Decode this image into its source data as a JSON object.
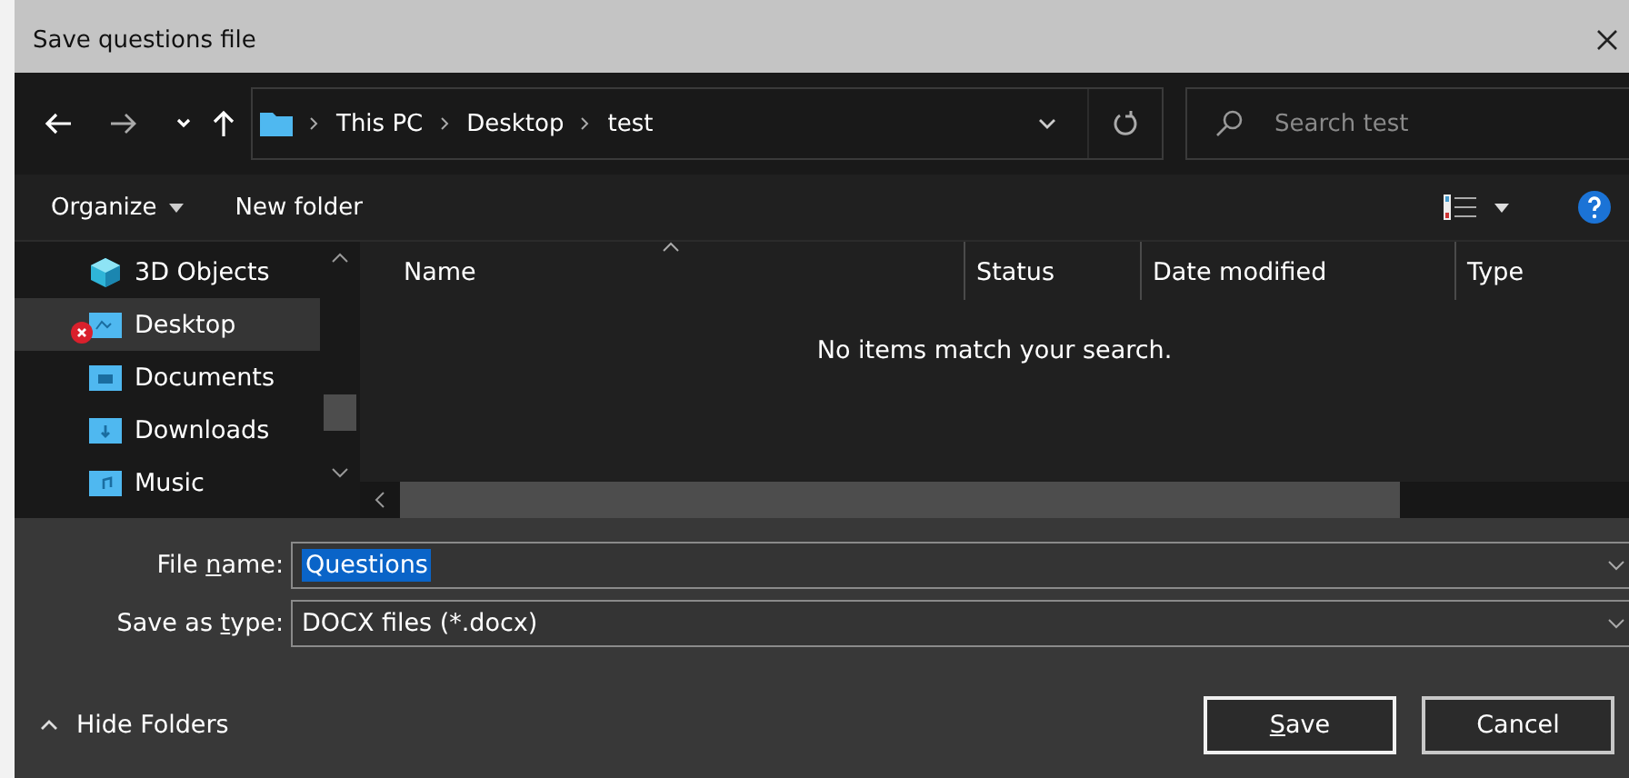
{
  "window": {
    "title": "Save questions file"
  },
  "address": {
    "breadcrumbs": [
      "This PC",
      "Desktop",
      "test"
    ]
  },
  "search": {
    "placeholder": "Search test"
  },
  "toolbar": {
    "organize": "Organize",
    "new_folder": "New folder"
  },
  "sidebar": {
    "items": [
      {
        "label": "3D Objects",
        "kind": "cube",
        "selected": false,
        "error": false
      },
      {
        "label": "Desktop",
        "kind": "desktop",
        "selected": true,
        "error": true
      },
      {
        "label": "Documents",
        "kind": "documents",
        "selected": false,
        "error": false
      },
      {
        "label": "Downloads",
        "kind": "downloads",
        "selected": false,
        "error": false
      },
      {
        "label": "Music",
        "kind": "music",
        "selected": false,
        "error": false
      }
    ]
  },
  "table": {
    "columns": [
      {
        "label": "Name",
        "sorted": true
      },
      {
        "label": "Status",
        "sorted": false
      },
      {
        "label": "Date modified",
        "sorted": false
      },
      {
        "label": "Type",
        "sorted": false
      }
    ],
    "empty_message": "No items match your search."
  },
  "file_name": {
    "label_parts": [
      "File ",
      "n",
      "ame:"
    ],
    "value": "Questions",
    "selected": true
  },
  "save_type": {
    "label_parts": [
      "Save as ",
      "t",
      "ype:"
    ],
    "value": "DOCX files (*.docx)"
  },
  "hide_folders": "Hide Folders",
  "buttons": [
    {
      "key": "S",
      "after": "ave",
      "default": true
    },
    {
      "before": "Cancel",
      "default": false
    }
  ]
}
